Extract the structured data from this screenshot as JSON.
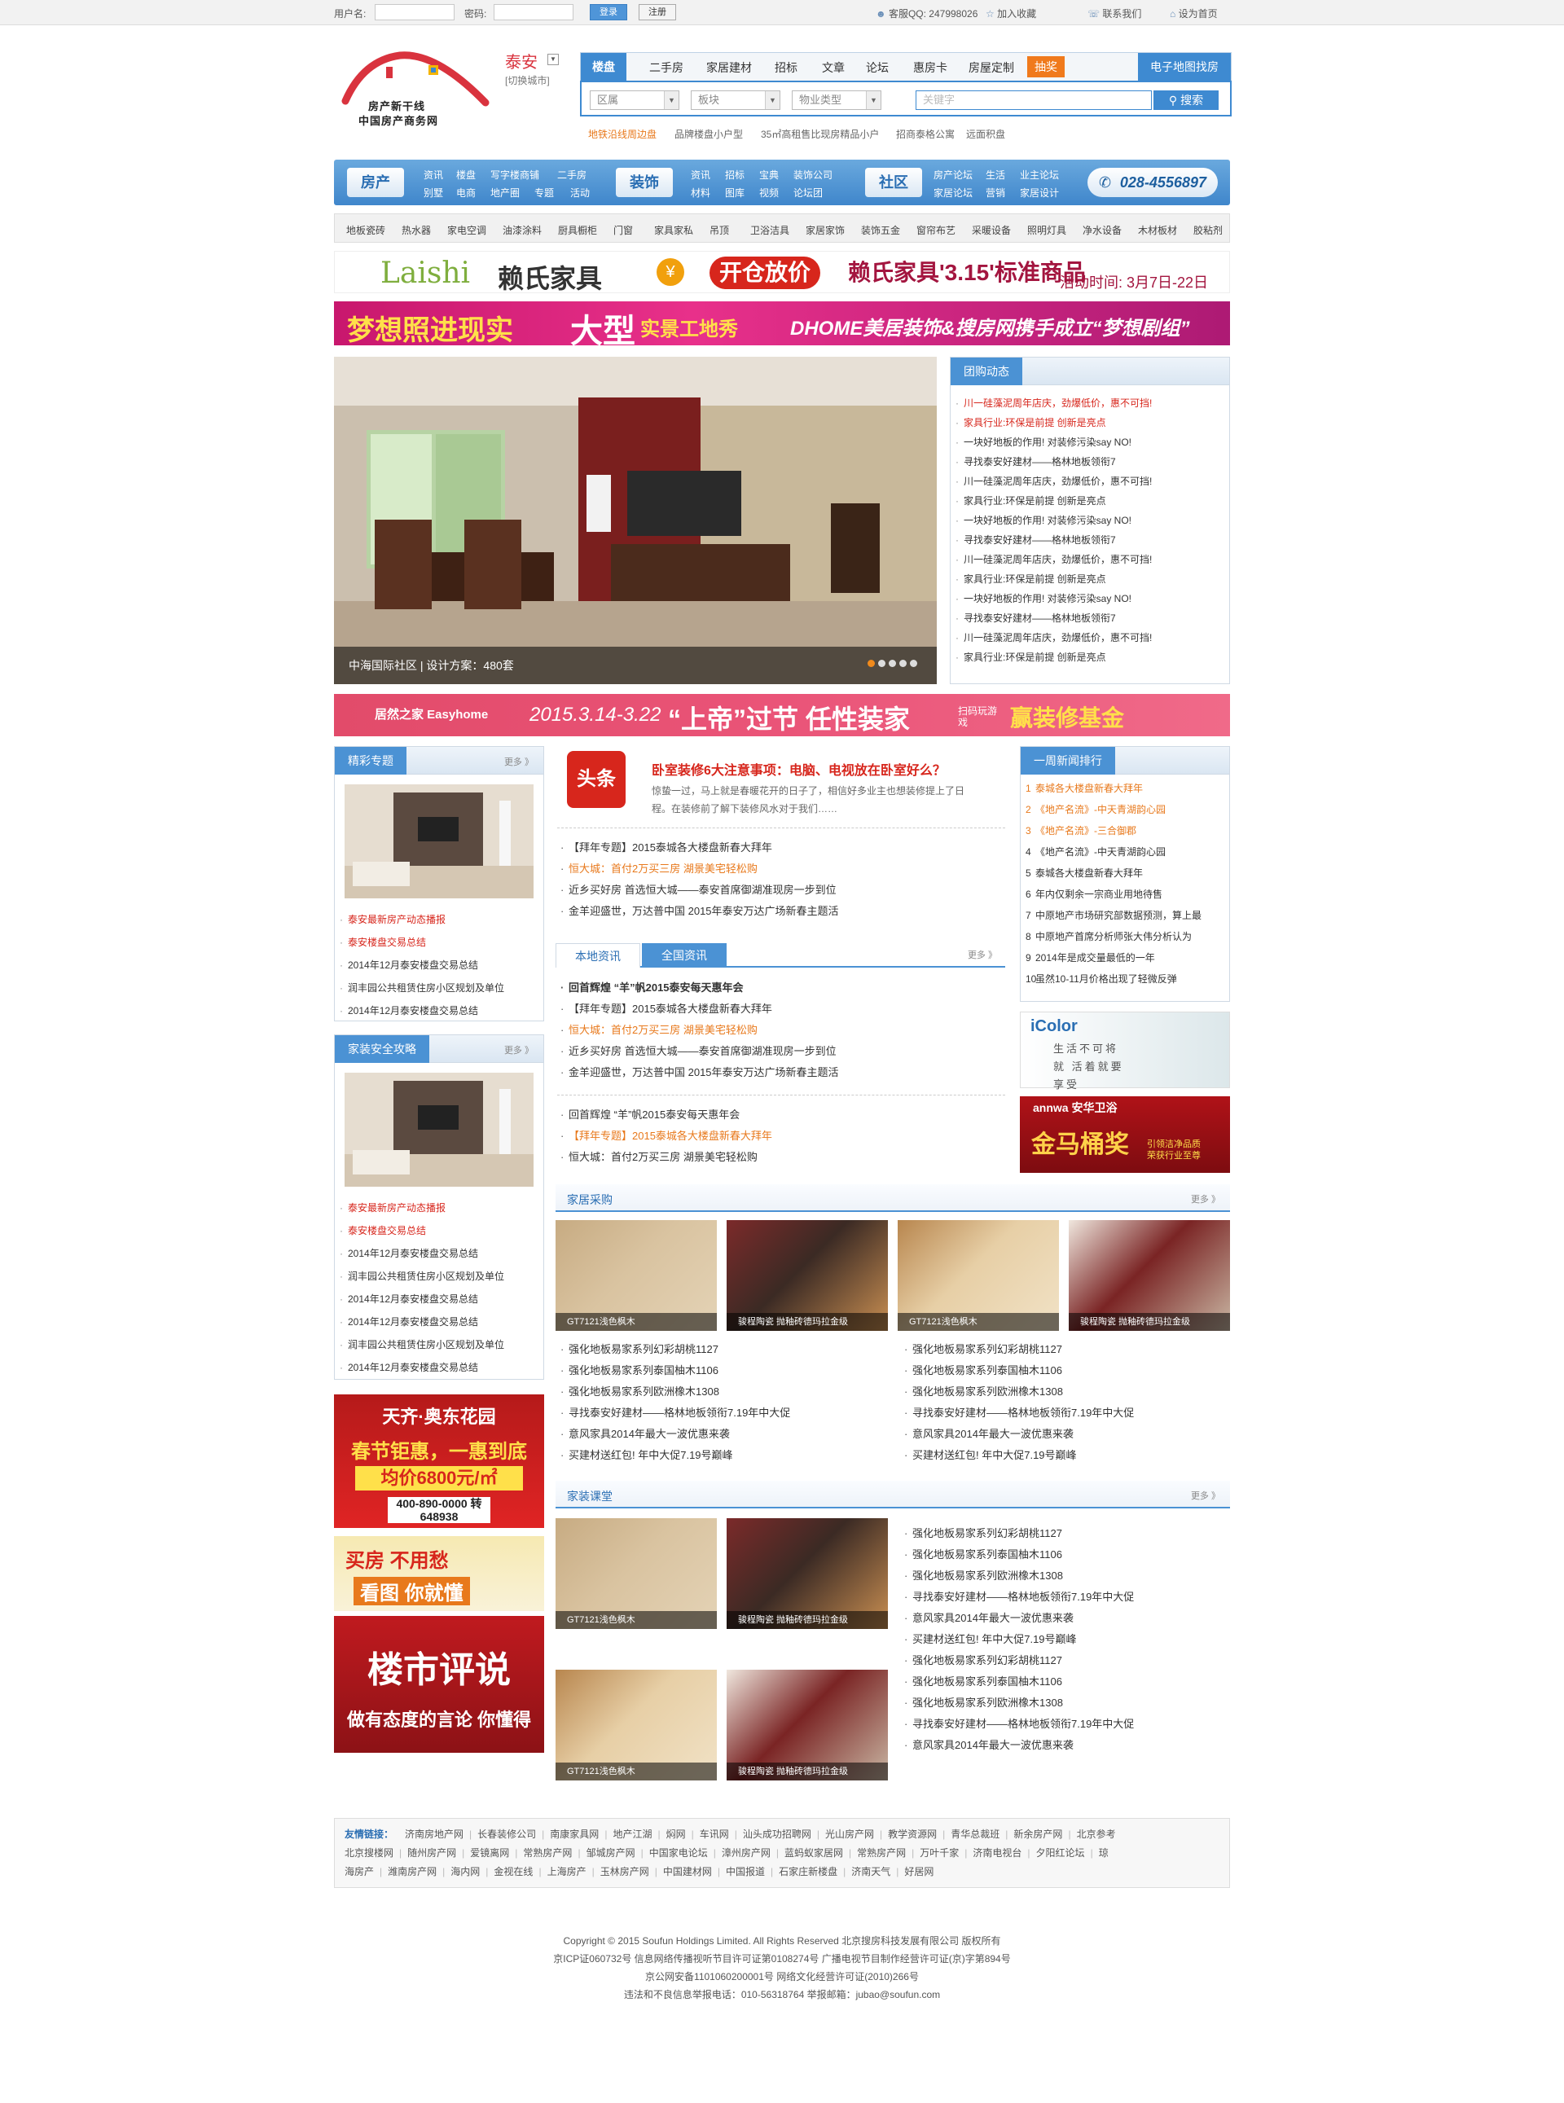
{
  "topbar": {
    "username_label": "用户名:",
    "password_label": "密码:",
    "login": "登录",
    "register": "注册",
    "qq": "客服QQ: 247998026",
    "fav": "加入收藏",
    "contact": "联系我们",
    "homepage": "设为首页"
  },
  "logo": {
    "line1": "房产新干线",
    "line2": "中国房产商务网"
  },
  "city": {
    "name": "泰安",
    "switch": "[切换城市]"
  },
  "search": {
    "tabs": [
      "楼盘",
      "二手房",
      "家居建材",
      "招标",
      "文章",
      "论坛",
      "惠房卡",
      "房屋定制",
      "抽奖"
    ],
    "map": "电子地图找房",
    "selects": [
      "区属",
      "板块",
      "物业类型"
    ],
    "placeholder": "关键字",
    "button": "搜索",
    "hot": [
      "地铁沿线周边盘",
      "品牌楼盘小户型",
      "35㎡高租售比现房精品小户",
      "招商泰格公寓",
      "远面积盘"
    ]
  },
  "nav": {
    "sec1": "房产",
    "sec1_links": [
      "资讯",
      "楼盘",
      "写字楼商铺",
      "二手房",
      "别墅",
      "电商",
      "地产圈",
      "专题",
      "活动"
    ],
    "sec2": "装饰",
    "sec2_links": [
      "资讯",
      "招标",
      "宝典",
      "装饰公司",
      "材料",
      "图库",
      "视频",
      "论坛团"
    ],
    "sec3": "社区",
    "sec3_links": [
      "房产论坛",
      "生活",
      "业主论坛",
      "家居论坛",
      "营销",
      "家居设计"
    ],
    "tel": "028-4556897"
  },
  "categories": [
    "地板瓷砖",
    "热水器",
    "家电空调",
    "油漆涂料",
    "厨具橱柜",
    "门窗",
    "家具家私",
    "吊顶",
    "卫浴洁具",
    "家居家饰",
    "装饰五金",
    "窗帘布艺",
    "采暖设备",
    "照明灯具",
    "净水设备",
    "木材板材",
    "胶粘剂"
  ],
  "banners": {
    "b1_brand": "Laishi",
    "b1_cn": "赖氏家具",
    "b1_sale": "开仓放价",
    "b1_slogan": "赖氏家具'3.15'标准商品",
    "b1_date": "活动时间: 3月7日-22日",
    "b2_left": "梦想照进现实",
    "b2_big": "大型",
    "b2_tag": "实景工地秀",
    "b2_right": "DHOME美居装饰&搜房网携手成立“梦想剧组”",
    "b3_brand": "居然之家 Easyhome",
    "b3_date": "2015.3.14-3.22",
    "b3_slogan": "“上帝”过节 任性装家",
    "b3_scan": "扫码玩游戏",
    "b3_gold": "赢装修基金"
  },
  "hero": {
    "caption": "中海国际社区  |  设计方案：480套"
  },
  "group": {
    "title": "团购动态",
    "items": [
      {
        "t": "川一硅藻泥周年店庆，劲爆低价，惠不可挡!",
        "red": true
      },
      {
        "t": "家具行业:环保是前提 创新是亮点",
        "red": true
      },
      {
        "t": "一块好地板的作用! 对装修污染say NO!",
        "red": false
      },
      {
        "t": "寻找泰安好建材——格林地板领衔7",
        "red": false
      },
      {
        "t": "川一硅藻泥周年店庆，劲爆低价，惠不可挡!",
        "red": false
      },
      {
        "t": "家具行业:环保是前提 创新是亮点",
        "red": false
      },
      {
        "t": "一块好地板的作用! 对装修污染say NO!",
        "red": false
      },
      {
        "t": "寻找泰安好建材——格林地板领衔7",
        "red": false
      },
      {
        "t": "川一硅藻泥周年店庆，劲爆低价，惠不可挡!",
        "red": false
      },
      {
        "t": "家具行业:环保是前提 创新是亮点",
        "red": false
      },
      {
        "t": "一块好地板的作用! 对装修污染say NO!",
        "red": false
      },
      {
        "t": "寻找泰安好建材——格林地板领衔7",
        "red": false
      },
      {
        "t": "川一硅藻泥周年店庆，劲爆低价，惠不可挡!",
        "red": false
      },
      {
        "t": "家具行业:环保是前提 创新是亮点",
        "red": false
      }
    ]
  },
  "feature": {
    "title": "精彩专题",
    "more": "更多 》",
    "items": [
      {
        "t": "泰安最新房产动态播报",
        "red": true
      },
      {
        "t": "泰安楼盘交易总结",
        "red": true
      },
      {
        "t": "2014年12月泰安楼盘交易总结",
        "red": false
      },
      {
        "t": "润丰园公共租赁住房小区规划及单位",
        "red": false
      },
      {
        "t": "2014年12月泰安楼盘交易总结",
        "red": false
      }
    ]
  },
  "safety": {
    "title": "家装安全攻略",
    "more": "更多 》",
    "items": [
      {
        "t": "泰安最新房产动态播报",
        "red": true
      },
      {
        "t": "泰安楼盘交易总结",
        "red": true
      },
      {
        "t": "2014年12月泰安楼盘交易总结",
        "red": false
      },
      {
        "t": "润丰园公共租赁住房小区规划及单位",
        "red": false
      },
      {
        "t": "2014年12月泰安楼盘交易总结",
        "red": false
      },
      {
        "t": "2014年12月泰安楼盘交易总结",
        "red": false
      },
      {
        "t": "润丰园公共租赁住房小区规划及单位",
        "red": false
      },
      {
        "t": "2014年12月泰安楼盘交易总结",
        "red": false
      }
    ]
  },
  "left_ads": {
    "ad1_title": "天齐·奥东花园",
    "ad1_line": "春节钜惠，一惠到底",
    "ad1_price": "均价6800元/㎡",
    "ad1_tel": "400-890-0000 转 648938",
    "ad2_a": "买房 不用愁",
    "ad2_b": "看图 你就懂",
    "ad3_a": "楼市评说",
    "ad3_b": "做有态度的言论 你懂得"
  },
  "headline": {
    "badge": "头条",
    "title": "卧室装修6大注意事项：电脑、电视放在卧室好么？",
    "desc": "惊蛰一过，马上就是春暖花开的日子了，相信好多业主也想装修提上了日程。在装修前了解下装修风水对于我们……",
    "list": [
      {
        "t": "【拜年专题】2015泰城各大楼盘新春大拜年",
        "c": ""
      },
      {
        "t": "恒大城：首付2万买三房 湖景美宅轻松购",
        "c": "or"
      },
      {
        "t": "近乡买好房 首选恒大城——泰安首席御湖准现房一步到位",
        "c": ""
      },
      {
        "t": "金羊迎盛世，万达普中国 2015年泰安万达广场新春主题活",
        "c": ""
      }
    ]
  },
  "newstabs": {
    "tab1": "本地资讯",
    "tab2": "全国资讯",
    "more": "更多 》",
    "list": [
      {
        "t": "回首辉煌 “羊”帆2015泰安每天惠年会",
        "c": "b"
      },
      {
        "t": "【拜年专题】2015泰城各大楼盘新春大拜年",
        "c": ""
      },
      {
        "t": "恒大城：首付2万买三房 湖景美宅轻松购",
        "c": "or"
      },
      {
        "t": "近乡买好房 首选恒大城——泰安首席御湖准现房一步到位",
        "c": ""
      },
      {
        "t": "金羊迎盛世，万达普中国 2015年泰安万达广场新春主题活",
        "c": ""
      }
    ],
    "list2": [
      {
        "t": "回首辉煌 “羊”帆2015泰安每天惠年会",
        "c": ""
      },
      {
        "t": "【拜年专题】2015泰城各大楼盘新春大拜年",
        "c": "or"
      },
      {
        "t": "恒大城：首付2万买三房 湖景美宅轻松购",
        "c": ""
      }
    ]
  },
  "rank": {
    "title": "一周新闻排行",
    "items": [
      {
        "t": "泰城各大楼盘新春大拜年",
        "or": true
      },
      {
        "t": "《地产名流》-中天青湖韵心园",
        "or": true
      },
      {
        "t": "《地产名流》-三合御郡",
        "or": true
      },
      {
        "t": "《地产名流》-中天青湖韵心园",
        "or": false
      },
      {
        "t": "泰城各大楼盘新春大拜年",
        "or": false
      },
      {
        "t": "年内仅剩余一宗商业用地待售",
        "or": false
      },
      {
        "t": "中原地产市场研究部数据预测，算上最",
        "or": false
      },
      {
        "t": "中原地产首席分析师张大伟分析认为",
        "or": false
      },
      {
        "t": "2014年是成交量最低的一年",
        "or": false
      },
      {
        "t": "虽然10-11月价格出现了轻微反弹",
        "or": false
      }
    ],
    "ad1_brand": "iColor",
    "ad1_text": "生活不可将就 活着就要享受",
    "ad2_brand": "annwa 安华卫浴",
    "ad2_text": "金马桶奖",
    "ad2_sub": "引领洁净品质 荣获行业至尊"
  },
  "purchase": {
    "title": "家居采购",
    "more": "更多 》",
    "thumbs": [
      "GT7121浅色枫木",
      "骏程陶瓷 抛釉砖德玛拉金级",
      "GT7121浅色枫木",
      "骏程陶瓷 抛釉砖德玛拉金级"
    ],
    "col1": [
      "强化地板易家系列幻彩胡桃1127",
      "强化地板易家系列泰国柚木1106",
      "强化地板易家系列欧洲橡木1308",
      "寻找泰安好建材——格林地板领衔7.19年中大促",
      "意风家具2014年最大一波优惠来袭",
      "买建材送红包! 年中大促7.19号巅峰"
    ],
    "col2": [
      "强化地板易家系列幻彩胡桃1127",
      "强化地板易家系列泰国柚木1106",
      "强化地板易家系列欧洲橡木1308",
      "寻找泰安好建材——格林地板领衔7.19年中大促",
      "意风家具2014年最大一波优惠来袭",
      "买建材送红包! 年中大促7.19号巅峰"
    ]
  },
  "classroom": {
    "title": "家装课堂",
    "more": "更多 》",
    "thumbs": [
      "GT7121浅色枫木",
      "骏程陶瓷 抛釉砖德玛拉金级",
      "GT7121浅色枫木",
      "骏程陶瓷 抛釉砖德玛拉金级"
    ],
    "list": [
      "强化地板易家系列幻彩胡桃1127",
      "强化地板易家系列泰国柚木1106",
      "强化地板易家系列欧洲橡木1308",
      "寻找泰安好建材——格林地板领衔7.19年中大促",
      "意风家具2014年最大一波优惠来袭",
      "买建材送红包! 年中大促7.19号巅峰",
      "强化地板易家系列幻彩胡桃1127",
      "强化地板易家系列泰国柚木1106",
      "强化地板易家系列欧洲橡木1308",
      "寻找泰安好建材——格林地板领衔7.19年中大促",
      "意风家具2014年最大一波优惠来袭"
    ]
  },
  "links": {
    "label": "友情链接：",
    "row1": [
      "济南房地产网",
      "长春装修公司",
      "南康家具网",
      "地产江湖",
      "焖网",
      "车讯网",
      "汕头成功招聘网",
      "光山房产网",
      "教学资源网",
      "青华总裁班",
      "新余房产网",
      "北京参考"
    ],
    "row2": [
      "北京搜楼网",
      "随州房产网",
      "爱镜离网",
      "常熟房产网",
      "邹城房产网",
      "中国家电论坛",
      "漳州房产网",
      "蓝蚂蚁家居网",
      "常熟房产网",
      "万叶千家",
      "济南电视台",
      "夕阳红论坛",
      "琼"
    ],
    "row3": [
      "海房产",
      "潍南房产网",
      "海内网",
      "金视在线",
      "上海房产",
      "玉林房产网",
      "中国建材网",
      "中国报道",
      "石家庄新楼盘",
      "济南天气",
      "好居网"
    ]
  },
  "footer": {
    "l1": "Copyright © 2015 Soufun Holdings Limited. All Rights Reserved 北京搜房科技发展有限公司 版权所有",
    "l2": "京ICP证060732号 信息网络传播视听节目许可证第0108274号 广播电视节目制作经营许可证(京)字第894号",
    "l3": "京公网安备1101060200001号 网络文化经营许可证(2010)266号",
    "l4": "违法和不良信息举报电话：010-56318764 举报邮箱：jubao@soufun.com"
  },
  "colors": {
    "blue": "#3e8ad1",
    "orange": "#e8791c",
    "red": "#d7261c"
  }
}
